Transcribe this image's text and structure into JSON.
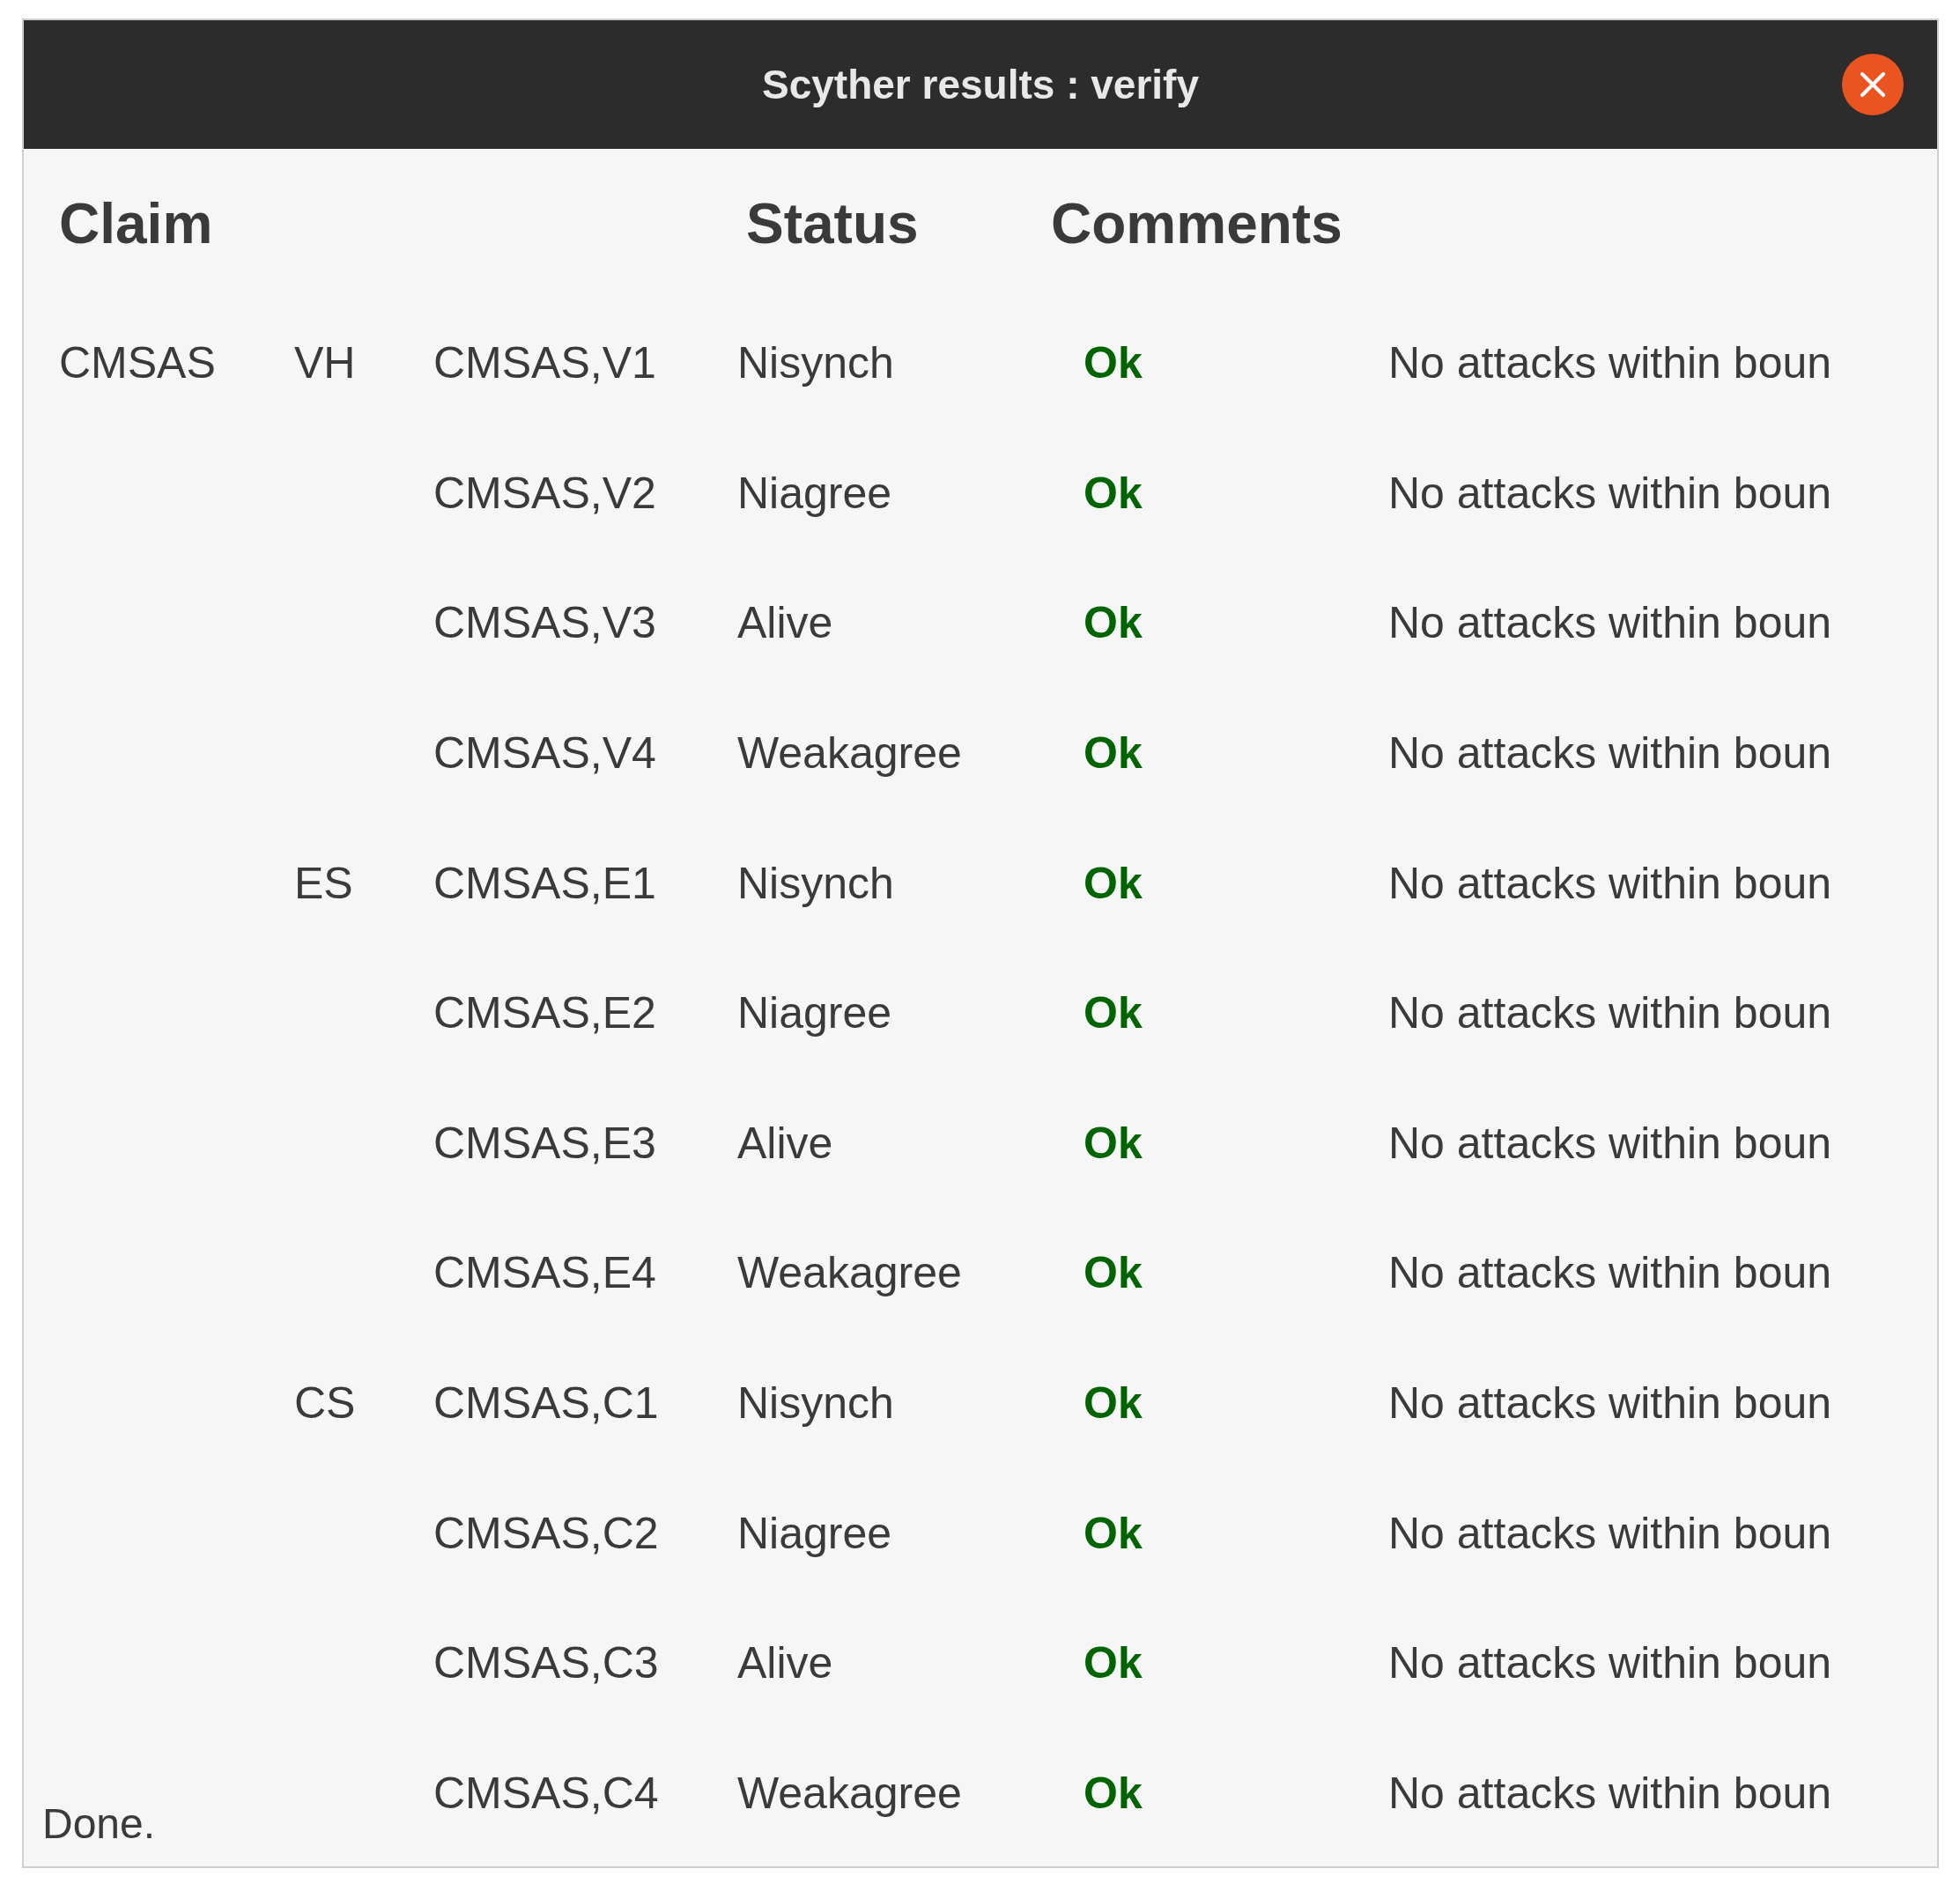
{
  "window": {
    "title": "Scyther results : verify"
  },
  "table": {
    "columns": [
      "Claim",
      "Status",
      "Comments"
    ],
    "rows": [
      {
        "protocol": "CMSAS",
        "role": "VH",
        "claim": "CMSAS,V1",
        "type": "Nisynch",
        "status": "Ok",
        "comment": "No attacks within boun"
      },
      {
        "claim": "CMSAS,V2",
        "type": "Niagree",
        "status": "Ok",
        "comment": "No attacks within boun"
      },
      {
        "claim": "CMSAS,V3",
        "type": "Alive",
        "status": "Ok",
        "comment": "No attacks within boun"
      },
      {
        "claim": "CMSAS,V4",
        "type": "Weakagree",
        "status": "Ok",
        "comment": "No attacks within boun"
      },
      {
        "role": "ES",
        "claim": "CMSAS,E1",
        "type": "Nisynch",
        "status": "Ok",
        "comment": "No attacks within boun"
      },
      {
        "claim": "CMSAS,E2",
        "type": "Niagree",
        "status": "Ok",
        "comment": "No attacks within boun"
      },
      {
        "claim": "CMSAS,E3",
        "type": "Alive",
        "status": "Ok",
        "comment": "No attacks within boun"
      },
      {
        "claim": "CMSAS,E4",
        "type": "Weakagree",
        "status": "Ok",
        "comment": "No attacks within boun"
      },
      {
        "role": "CS",
        "claim": "CMSAS,C1",
        "type": "Nisynch",
        "status": "Ok",
        "comment": "No attacks within boun"
      },
      {
        "claim": "CMSAS,C2",
        "type": "Niagree",
        "status": "Ok",
        "comment": "No attacks within boun"
      },
      {
        "claim": "CMSAS,C3",
        "type": "Alive",
        "status": "Ok",
        "comment": "No attacks within boun"
      },
      {
        "claim": "CMSAS,C4",
        "type": "Weakagree",
        "status": "Ok",
        "comment": "No attacks within boun"
      }
    ]
  },
  "status_bar": "Done."
}
